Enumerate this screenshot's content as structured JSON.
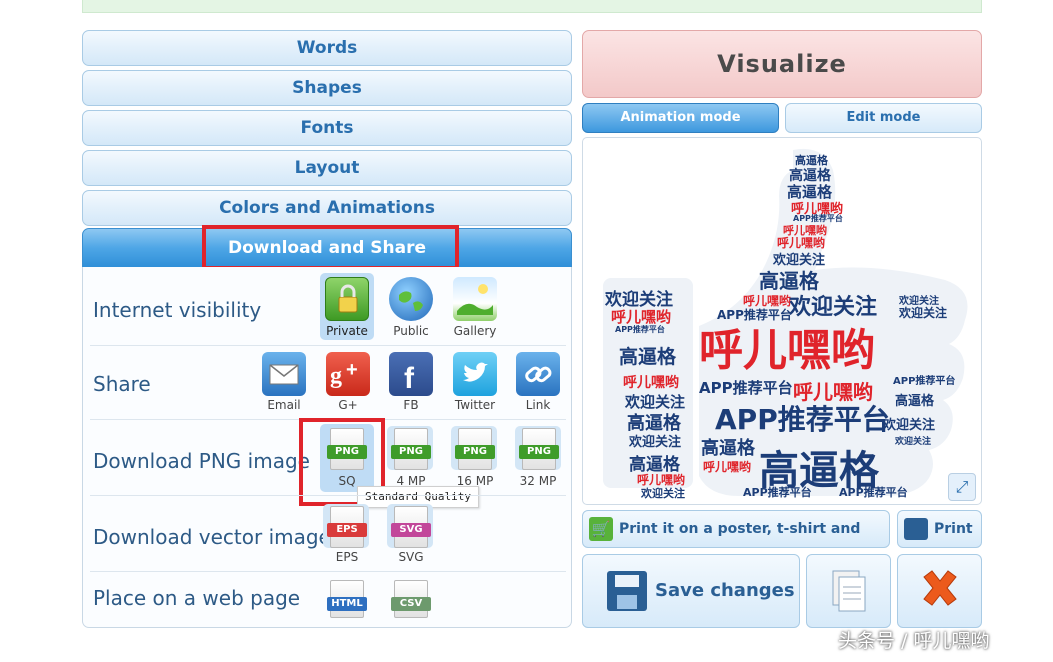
{
  "accordion": {
    "words": "Words",
    "shapes": "Shapes",
    "fonts": "Fonts",
    "layout": "Layout",
    "colors": "Colors and Animations",
    "download": "Download and Share"
  },
  "visibility": {
    "label": "Internet visibility",
    "private": "Private",
    "public": "Public",
    "gallery": "Gallery",
    "selected": "Private"
  },
  "share": {
    "label": "Share",
    "email": "Email",
    "gplus": "G+",
    "fb": "FB",
    "twitter": "Twitter",
    "link": "Link"
  },
  "png": {
    "label": "Download PNG image",
    "tag": "PNG",
    "sq": "SQ",
    "mp4": "4 MP",
    "mp16": "16 MP",
    "mp32": "32 MP",
    "tooltip": "Standard Quality"
  },
  "vector": {
    "label": "Download vector image",
    "eps_tag": "EPS",
    "svg_tag": "SVG",
    "eps": "EPS",
    "svg": "SVG"
  },
  "web": {
    "label": "Place on a web page",
    "html_tag": "HTML",
    "csv_tag": "CSV"
  },
  "right": {
    "visualize": "Visualize",
    "animation_mode": "Animation mode",
    "edit_mode": "Edit mode",
    "print_poster": "Print it on a poster, t-shirt and more!",
    "print": "Print",
    "save": "Save changes"
  },
  "cloud": {
    "w1": "呼儿嘿哟",
    "w2": "高逼格",
    "w3": "APP推荐平台",
    "w4": "欢迎关注"
  },
  "watermark": "头条号 / 呼儿嘿哟",
  "colors": {
    "navy": "#1c3d78",
    "red": "#e0242b",
    "accent": "#2f8fd8"
  }
}
